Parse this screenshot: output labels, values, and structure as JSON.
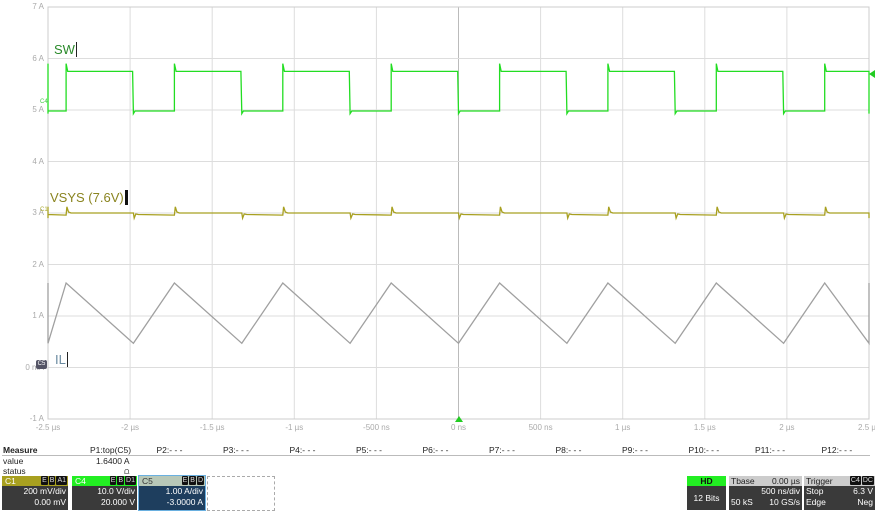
{
  "chart_data": {
    "type": "line",
    "xlim": [
      -2.5,
      2.5
    ],
    "ylim": [
      -1,
      7
    ],
    "grid": true,
    "x_ticks": [
      "-2.5 µs",
      "-2 µs",
      "-1.5 µs",
      "-1 µs",
      "-500 ns",
      "0 ns",
      "500 ns",
      "1 µs",
      "1.5 µs",
      "2 µs",
      "2.5 µs"
    ],
    "y_ticks": [
      "7 A",
      "6 A",
      "5 A",
      "4 A",
      "3 A",
      "2 A",
      "1 A",
      "0 mA",
      "-1 A"
    ],
    "series": [
      {
        "name": "SW",
        "color": "#22dd22",
        "kind": "square",
        "period_us": 0.66,
        "first_rise_us": -2.39,
        "high_time_us": 0.41,
        "high": 5.75,
        "low": 4.98
      },
      {
        "name": "VSYS (7.6V)",
        "color": "#a8a020",
        "kind": "flat",
        "level": 3.0,
        "period_us": 0.66,
        "first_rise_us": -2.39,
        "high_time_us": 0.41
      },
      {
        "name": "IL",
        "color": "#a0a0a0",
        "kind": "triangle",
        "period_us": 0.66,
        "first_peak_us": -2.39,
        "fall_time_us": 0.41,
        "peak": 1.64,
        "valley": 0.47
      }
    ]
  },
  "markers": {
    "c4": "C4",
    "c1": "C1",
    "c5": "C5"
  },
  "measure": {
    "title": "Measure",
    "row_value": "value",
    "row_status": "status",
    "params": [
      "P1:top(C5)",
      "P2:- - -",
      "P3:- - -",
      "P4:- - -",
      "P5:- - -",
      "P6:- - -",
      "P7:- - -",
      "P8:- - -",
      "P9:- - -",
      "P10:- - -",
      "P11:- - -",
      "P12:- - -"
    ],
    "p1_value": "1.6400 A",
    "p1_status": "⩍"
  },
  "channels": [
    {
      "name": "C1",
      "tags": [
        "E",
        "B",
        "A1"
      ],
      "scale": "200 mV/div",
      "offset": "0.00 mV",
      "color": "#a8a020"
    },
    {
      "name": "C4",
      "tags": [
        "E",
        "B",
        "D1"
      ],
      "scale": "10.0 V/div",
      "offset": "20.000 V",
      "color": "#22ee22"
    },
    {
      "name": "C5",
      "tags": [
        "E",
        "B",
        "D"
      ],
      "scale": "1.00 A/div",
      "offset": "-3.0000 A",
      "color": "#b8c8b8"
    }
  ],
  "acq": {
    "mode": "HD",
    "bits": "12 Bits"
  },
  "timebase": {
    "label": "Tbase",
    "delay": "0.00 µs",
    "scale": "500 ns/div",
    "samples": "50 kS",
    "rate": "10 GS/s"
  },
  "trigger": {
    "label": "Trigger",
    "tags": [
      "C4",
      "DC"
    ],
    "mode": "Stop",
    "level": "6.3 V",
    "type": "Edge",
    "slope": "Neg"
  }
}
